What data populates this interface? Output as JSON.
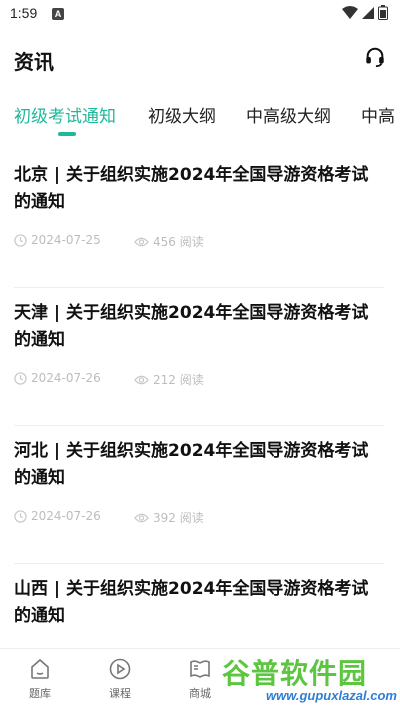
{
  "status_bar": {
    "time": "1:59",
    "app_icon": "A"
  },
  "header": {
    "title": "资讯",
    "support_icon": "headset-icon"
  },
  "tabs": [
    {
      "label": "初级考试通知",
      "active": true
    },
    {
      "label": "初级大纲",
      "active": false
    },
    {
      "label": "中高级大纲",
      "active": false
    },
    {
      "label": "中高",
      "active": false
    }
  ],
  "news": [
    {
      "title": "北京 | 关于组织实施2024年全国导游资格考试的通知",
      "date": "2024-07-25",
      "views": "456 阅读"
    },
    {
      "title": "天津 | 关于组织实施2024年全国导游资格考试的通知",
      "date": "2024-07-26",
      "views": "212 阅读"
    },
    {
      "title": "河北 | 关于组织实施2024年全国导游资格考试的通知",
      "date": "2024-07-26",
      "views": "392 阅读"
    },
    {
      "title": "山西 | 关于组织实施2024年全国导游资格考试的通知",
      "date": "",
      "views": ""
    }
  ],
  "bottom_nav": [
    {
      "label": "题库",
      "icon": "question-bank-icon"
    },
    {
      "label": "课程",
      "icon": "play-circle-icon"
    },
    {
      "label": "商城",
      "icon": "book-icon"
    }
  ],
  "watermark": {
    "top": "谷普软件园",
    "bottom": "www.gupuxlazal.com"
  },
  "colors": {
    "accent": "#1fb89a",
    "meta": "#bdbdbd"
  }
}
